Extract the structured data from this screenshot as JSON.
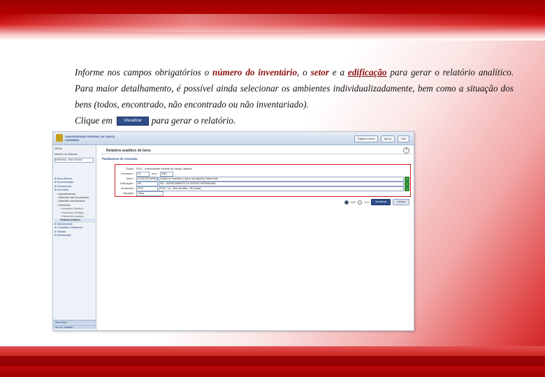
{
  "instructions": {
    "p1_a": "Informe nos campos obrigatórios o ",
    "p1_b": "número do inventário",
    "p1_c": ", o ",
    "p1_d": "setor",
    "p1_e": " e a ",
    "p1_f": "edificação",
    "p1_g": " para gerar o relatório analítico. Para maior detalhamento, é possível ainda selecionar os ambientes individualizadamente, bem como a situação dos bens (todos, encontrado, não encontrado ou não inventariado).",
    "p2_a": "Clique em",
    "p2_btn": "Visualizar",
    "p2_b": "para gerar o relatório."
  },
  "app": {
    "logo_text": "UNIVERSIDADE FEDERAL DE SANTA CATARINA",
    "top_buttons": [
      "Página Inicial",
      "Ajuda",
      "Sair"
    ],
    "menu_label": "MENU",
    "module_label": "Módulo do Sistema",
    "module_value": "Patrimônio - Bens Móveis",
    "menu_items": [
      {
        "label": "Meus Menus",
        "level": 1
      },
      {
        "label": "Movimentação",
        "level": 1
      },
      {
        "label": "Documentos",
        "level": 1
      },
      {
        "label": "Inventário",
        "level": 1
      },
      {
        "label": "Agendamentos",
        "level": 2
      },
      {
        "label": "Materiais não Encontrados",
        "level": 2
      },
      {
        "label": "Materiais Inventariados",
        "level": 2
      },
      {
        "label": "Relatórios",
        "level": 2
      },
      {
        "label": "Inventário Sintético",
        "level": 3
      },
      {
        "label": "Patrimônio Sintético",
        "level": 3
      },
      {
        "label": "Patrimônio Analítico",
        "level": 3
      },
      {
        "label": "Relatório analítico",
        "level": 4
      },
      {
        "label": "Manutenções",
        "level": 1
      },
      {
        "label": "Consultas e Relatórios",
        "level": 1
      },
      {
        "label": "Tabelas",
        "level": 1
      },
      {
        "label": "Manutenção",
        "level": 1
      }
    ],
    "footer_items": [
      "Meu Menu",
      "Ver do Trabalho"
    ],
    "page_title": "Relatório analítico de bens",
    "help_label": "?",
    "section_title": "Parâmetros de Consulta",
    "fields": {
      "orgao_label": "Órgão :",
      "orgao_value": "0751 - Universidade Federal de Santa Catarina",
      "inventario_label": "Inventário* :",
      "inventario_value": "04",
      "ano_label": "Ano* :",
      "ano_value": "2016",
      "setor_label": "Setor* :",
      "setor_code": "DGA/DGP/DIPBEM",
      "setor_desc": "Divisão de Inventário e Apoio aos Agentes Patrimoniais",
      "edificacao_label": "Edificação* :",
      "edificacao_code": "001",
      "edificacao_desc": "001 - DEPARTAMENTO DE GESTÃO PATRIMONIAL",
      "ambientes_label": "Ambientes :",
      "ambientes_code": "P410",
      "ambientes_desc": "P410 - 1A - Sala das Altas - 1B (Andar)",
      "situacao_label": "Situação :",
      "situacao_value": "Todos"
    },
    "format_options": [
      "PDF",
      "XLS"
    ],
    "visualizar_label": "Visualizar",
    "limpar_label": "Limpar"
  }
}
